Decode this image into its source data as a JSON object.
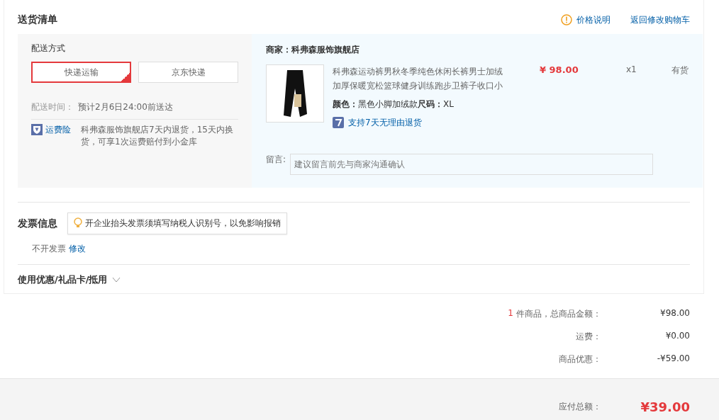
{
  "section_title": "送货清单",
  "header_links": [
    {
      "kind": "info",
      "label": "价格说明"
    },
    {
      "kind": "plain",
      "label": "返回修改购物车"
    }
  ],
  "shipping": {
    "title": "配送方式",
    "options": [
      {
        "label": "快递运输",
        "selected": true
      },
      {
        "label": "京东快递",
        "selected": false
      }
    ],
    "time_label": "配送时间：",
    "time_value": "预计2月6日24:00前送达",
    "insurance_label": "运费险",
    "insurance_text": "科弗森服饰旗舰店7天内退货，15天内换货，可享1次运费赔付到小金库"
  },
  "store": {
    "label": "商家：",
    "name": "科弗森服饰旗舰店"
  },
  "product": {
    "title": "科弗森运动裤男秋冬季纯色休闲长裤男士加绒加厚保暖宽松篮球健身训练跑步卫裤子收口小",
    "price": "¥ 98.00",
    "quantity": "x1",
    "stock": "有货",
    "specs": [
      {
        "label": "颜色：",
        "value": "黑色小脚加绒款"
      },
      {
        "label": "尺码：",
        "value": "XL"
      }
    ],
    "return_policy": "支持7天无理由退货"
  },
  "message": {
    "label": "留言:",
    "placeholder": "建议留言前先与商家沟通确认"
  },
  "invoice": {
    "title": "发票信息",
    "tip": "开企业抬头发票须填写纳税人识别号，以免影响报销",
    "value": "不开发票",
    "edit_link": "修改"
  },
  "coupons": {
    "title": "使用优惠/礼品卡/抵用",
    "expanded": false
  },
  "summary": [
    {
      "count": "1",
      "label": "件商品，总商品金额：",
      "value": "¥98.00"
    },
    {
      "label": "运费：",
      "value": "¥0.00"
    },
    {
      "label": "商品优惠：",
      "value": "-¥59.00"
    }
  ],
  "total": {
    "label": "应付总额：",
    "value": "¥39.00"
  }
}
